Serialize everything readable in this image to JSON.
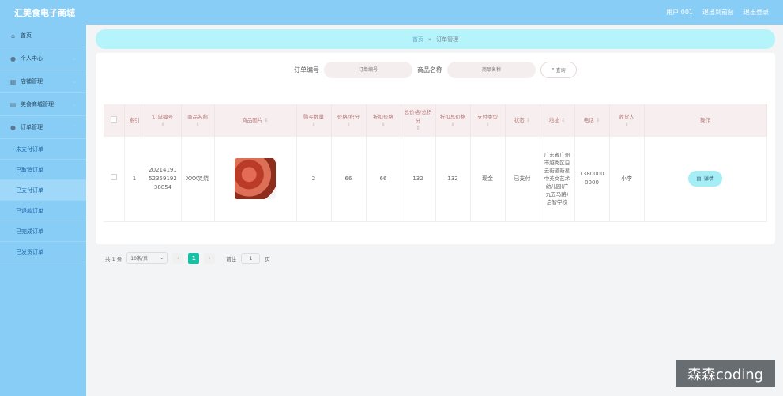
{
  "header": {
    "title": "汇美食电子商城",
    "user": "用户 001",
    "back_link": "退出到前台",
    "logout_link": "退出登录"
  },
  "sidebar": {
    "items": [
      {
        "label": "首页",
        "icon": "home-icon"
      },
      {
        "label": "个人中心",
        "icon": "user-icon"
      },
      {
        "label": "店铺管理",
        "icon": "store-icon"
      },
      {
        "label": "美食商城管理",
        "icon": "grid-icon"
      },
      {
        "label": "订单管理",
        "icon": "user-icon"
      }
    ],
    "sub_items": [
      "未支付订单",
      "已取消订单",
      "已支付订单",
      "已退款订单",
      "已完成订单",
      "已发货订单"
    ]
  },
  "breadcrumb": {
    "home": "首页",
    "separator": "»",
    "current": "订单管理"
  },
  "search": {
    "order_label": "订单编号",
    "order_placeholder": "订单编号",
    "product_label": "商品名称",
    "product_placeholder": "商品名称",
    "button": "查询"
  },
  "table": {
    "headers": [
      "索引",
      "订单编号",
      "商品名称",
      "商品图片",
      "购买数量",
      "价格/积分",
      "折扣价格",
      "总价格/总积分",
      "折扣总价格",
      "支付类型",
      "状态",
      "地址",
      "电话",
      "收货人",
      "操作"
    ],
    "rows": [
      {
        "index": "1",
        "order_no": "202141915235919238854",
        "product": "XXX叉烧",
        "qty": "2",
        "price": "66",
        "discount_price": "66",
        "total": "132",
        "discount_total": "132",
        "pay_type": "现金",
        "status": "已支付",
        "address": "广东省广州市越秀区白云街道新星中英文艺术幼儿园(广九五马路)启智学校",
        "phone": "13800000000",
        "receiver": "小李",
        "action": "详情"
      }
    ]
  },
  "pager": {
    "total": "共 1 条",
    "page_size": "10条/页",
    "current_page": "1",
    "goto_label": "前往",
    "goto_value": "1",
    "page_unit": "页"
  },
  "watermark": "森森coding",
  "colors": {
    "topbar": "#87cdf5",
    "sidebar": "#87cdf5",
    "breadcrumb": "#b5f4fa",
    "accent": "#17c1a5"
  }
}
